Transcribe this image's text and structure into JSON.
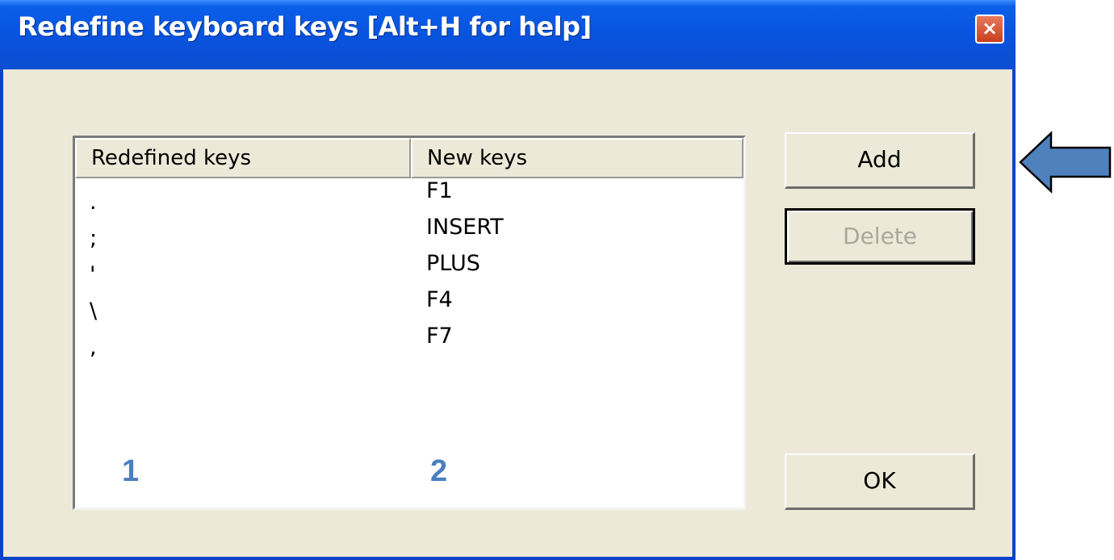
{
  "window": {
    "title": "Redefine keyboard keys [Alt+H for help]",
    "close_label": "×"
  },
  "list": {
    "columns": [
      "Redefined keys",
      "New keys"
    ],
    "rows": [
      {
        "old": ".",
        "new": "F1"
      },
      {
        "old": ";",
        "new": "INSERT"
      },
      {
        "old": "'",
        "new": "PLUS"
      },
      {
        "old": "\\",
        "new": "F4"
      },
      {
        "old": ",",
        "new": "F7"
      }
    ]
  },
  "callouts": {
    "one": "1",
    "two": "2"
  },
  "buttons": {
    "add": "Add",
    "delete": "Delete",
    "ok": "OK"
  },
  "colors": {
    "title_bar": "#0a54e0",
    "dialog_bg": "#ece9d8",
    "callout": "#4a7fc0",
    "arrow": "#4f81bd"
  },
  "annotation": {
    "arrow_icon": "left-arrow-icon"
  }
}
